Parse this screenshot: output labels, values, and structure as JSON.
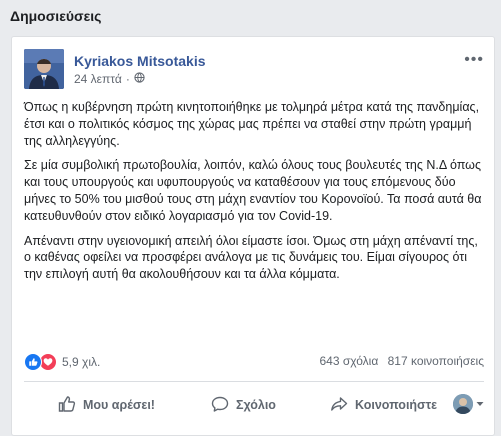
{
  "section": {
    "title": "Δημοσιεύσεις"
  },
  "post": {
    "author": "Kyriakos Mitsotakis",
    "time": "24 λεπτά",
    "paragraphs": [
      "Όπως η κυβέρνηση πρώτη κινητοποιήθηκε με τολμηρά μέτρα κατά της πανδημίας, έτσι και ο πολιτικός κόσμος της χώρας μας πρέπει να σταθεί στην πρώτη γραμμή της αλληλεγγύης.",
      "Σε μία συμβολική πρωτοβουλία, λοιπόν, καλώ όλους τους βουλευτές της Ν.Δ όπως και τους υπουργούς και υφυπουργούς να καταθέσουν για τους επόμενους δύο μήνες το 50% του μισθού τους στη μάχη εναντίον του Κορονοϊού. Τα ποσά αυτά θα κατευθυνθούν στον ειδικό λογαριασμό για τον Covid-19.",
      "Απέναντι στην υγειονομική απειλή όλοι είμαστε ίσοι. Όμως στη μάχη απέναντί της, ο καθένας οφείλει να προσφέρει ανάλογα με τις δυνάμεις του. Είμαι σίγουρος ότι την επιλογή αυτή θα ακολουθήσουν και τα άλλα κόμματα."
    ],
    "reactions_count": "5,9 χιλ.",
    "comments": "643 σχόλια",
    "shares": "817 κοινοποιήσεις"
  },
  "actions": {
    "like": "Μου αρέσει!",
    "comment": "Σχόλιο",
    "share": "Κοινοποιήστε"
  },
  "colors": {
    "author_link": "#385898",
    "like_blue": "#1877f2",
    "love_red": "#f33e58",
    "muted": "#606770"
  }
}
